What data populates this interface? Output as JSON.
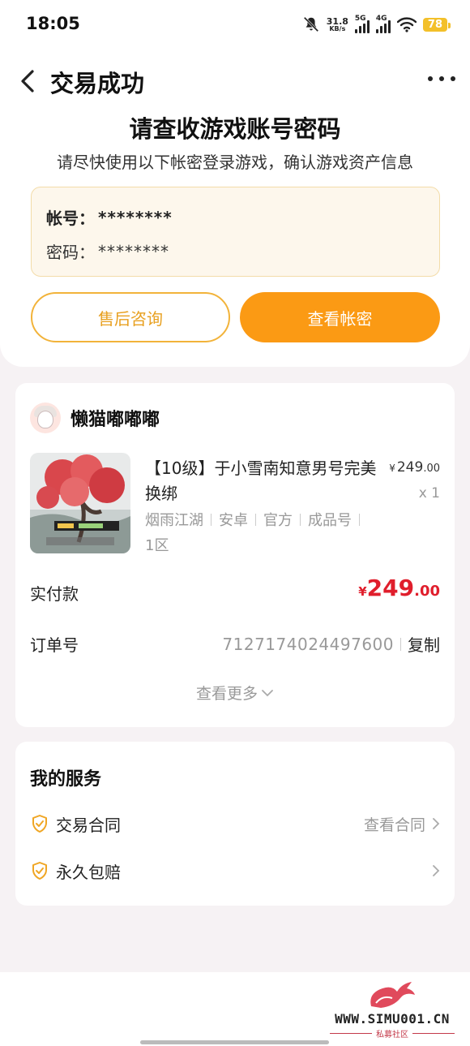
{
  "status_bar": {
    "time": "18:05",
    "net_speed": "31.8",
    "net_unit": "KB/s",
    "sim1": "5G",
    "sim2": "4G",
    "battery": "78",
    "icons": [
      "bell-off-icon",
      "signal-icon",
      "wifi-icon",
      "battery-icon"
    ]
  },
  "nav": {
    "title": "交易成功"
  },
  "header": {
    "heading": "请查收游戏账号密码",
    "subheading": "请尽快使用以下帐密登录游戏，确认游戏资产信息"
  },
  "credentials": {
    "account_label": "帐号：",
    "account_value": "********",
    "password_label": "密码：",
    "password_value": "********"
  },
  "buttons": {
    "after_sales": "售后咨询",
    "view_credentials": "查看帐密"
  },
  "order": {
    "seller_name": "懒猫嘟嘟嘟",
    "item_title": "【10级】于小雪南知意男号完美换绑",
    "price_symbol": "¥",
    "price_int": "249",
    "price_dec": ".00",
    "quantity": "x 1",
    "tags": [
      "烟雨江湖",
      "安卓",
      "官方",
      "成品号",
      "1区"
    ],
    "paid_label": "实付款",
    "paid_symbol": "¥",
    "paid_int": "249",
    "paid_dec": ".00",
    "order_no_label": "订单号",
    "order_no": "7127174024497600",
    "copy_label": "复制",
    "see_more": "查看更多"
  },
  "services": {
    "title": "我的服务",
    "items": [
      {
        "label": "交易合同",
        "action": "查看合同"
      },
      {
        "label": "永久包赔",
        "action": ""
      }
    ]
  },
  "watermark": {
    "text": "WWW.SIMU001.CN",
    "sub": "私募社区"
  },
  "colors": {
    "accent_orange": "#fb9a14",
    "outline_orange": "#f2b33a",
    "price_red": "#e01e2c",
    "cred_bg": "#fdf7ec"
  }
}
